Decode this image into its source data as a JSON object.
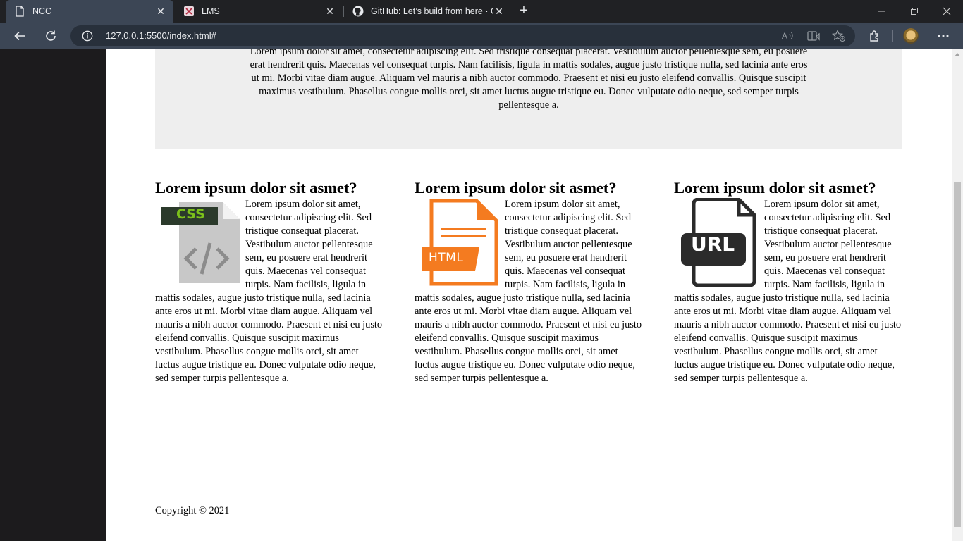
{
  "browser": {
    "tabs": [
      {
        "title": "NCC",
        "icon": "page-icon",
        "active": true
      },
      {
        "title": "LMS",
        "icon": "lms-icon",
        "active": false
      },
      {
        "title": "GitHub: Let’s build from here · Gi",
        "icon": "github-icon",
        "active": false
      }
    ],
    "new_tab": "+",
    "url": "127.0.0.1:5500/index.html#"
  },
  "page": {
    "hero_text": "Lorem ipsum dolor sit amet, consectetur adipiscing elit. Sed tristique consequat placerat. Vestibulum auctor pellentesque sem, eu posuere erat hendrerit quis. Maecenas vel consequat turpis. Nam facilisis, ligula in mattis sodales, augue justo tristique nulla, sed lacinia ante eros ut mi. Morbi vitae diam augue. Aliquam vel mauris a nibh auctor commodo. Praesent et nisi eu justo eleifend convallis. Quisque suscipit maximus vestibulum. Phasellus congue mollis orci, sit amet luctus augue tristique eu. Donec vulputate odio neque, sed semper turpis pellentesque a.",
    "columns": [
      {
        "heading": "Lorem ipsum dolor sit asmet?",
        "icon": "css-file-icon",
        "icon_label": "CSS",
        "icon_code": "</>",
        "text": "Lorem ipsum dolor sit amet, consectetur adipiscing elit. Sed tristique consequat placerat. Vestibulum auctor pellentesque sem, eu posuere erat hendrerit quis. Maecenas vel consequat turpis. Nam facilisis, ligula in mattis sodales, augue justo tristique nulla, sed lacinia ante eros ut mi. Morbi vitae diam augue. Aliquam vel mauris a nibh auctor commodo. Praesent et nisi eu justo eleifend convallis. Quisque suscipit maximus vestibulum. Phasellus congue mollis orci, sit amet luctus augue tristique eu. Donec vulputate odio neque, sed semper turpis pellentesque a."
      },
      {
        "heading": "Lorem ipsum dolor sit asmet?",
        "icon": "html-file-icon",
        "icon_label": "HTML",
        "text": "Lorem ipsum dolor sit amet, consectetur adipiscing elit. Sed tristique consequat placerat. Vestibulum auctor pellentesque sem, eu posuere erat hendrerit quis. Maecenas vel consequat turpis. Nam facilisis, ligula in mattis sodales, augue justo tristique nulla, sed lacinia ante eros ut mi. Morbi vitae diam augue. Aliquam vel mauris a nibh auctor commodo. Praesent et nisi eu justo eleifend convallis. Quisque suscipit maximus vestibulum. Phasellus congue mollis orci, sit amet luctus augue tristique eu. Donec vulputate odio neque, sed semper turpis pellentesque a."
      },
      {
        "heading": "Lorem ipsum dolor sit asmet?",
        "icon": "url-file-icon",
        "icon_label": "URL",
        "text": "Lorem ipsum dolor sit amet, consectetur adipiscing elit. Sed tristique consequat placerat. Vestibulum auctor pellentesque sem, eu posuere erat hendrerit quis. Maecenas vel consequat turpis. Nam facilisis, ligula in mattis sodales, augue justo tristique nulla, sed lacinia ante eros ut mi. Morbi vitae diam augue. Aliquam vel mauris a nibh auctor commodo. Praesent et nisi eu justo eleifend convallis. Quisque suscipit maximus vestibulum. Phasellus congue mollis orci, sit amet luctus augue tristique eu. Donec vulputate odio neque, sed semper turpis pellentesque a."
      }
    ],
    "copyright": "Copyright © 2021"
  },
  "colors": {
    "chrome_tabbar": "#202124",
    "chrome_toolbar": "#3c4655",
    "sidebar": "#1c1b1d",
    "hero_background": "#eeeeee",
    "css_accent": "#7cc11b",
    "html_accent": "#f47b20",
    "url_accent": "#2b2b2b"
  }
}
